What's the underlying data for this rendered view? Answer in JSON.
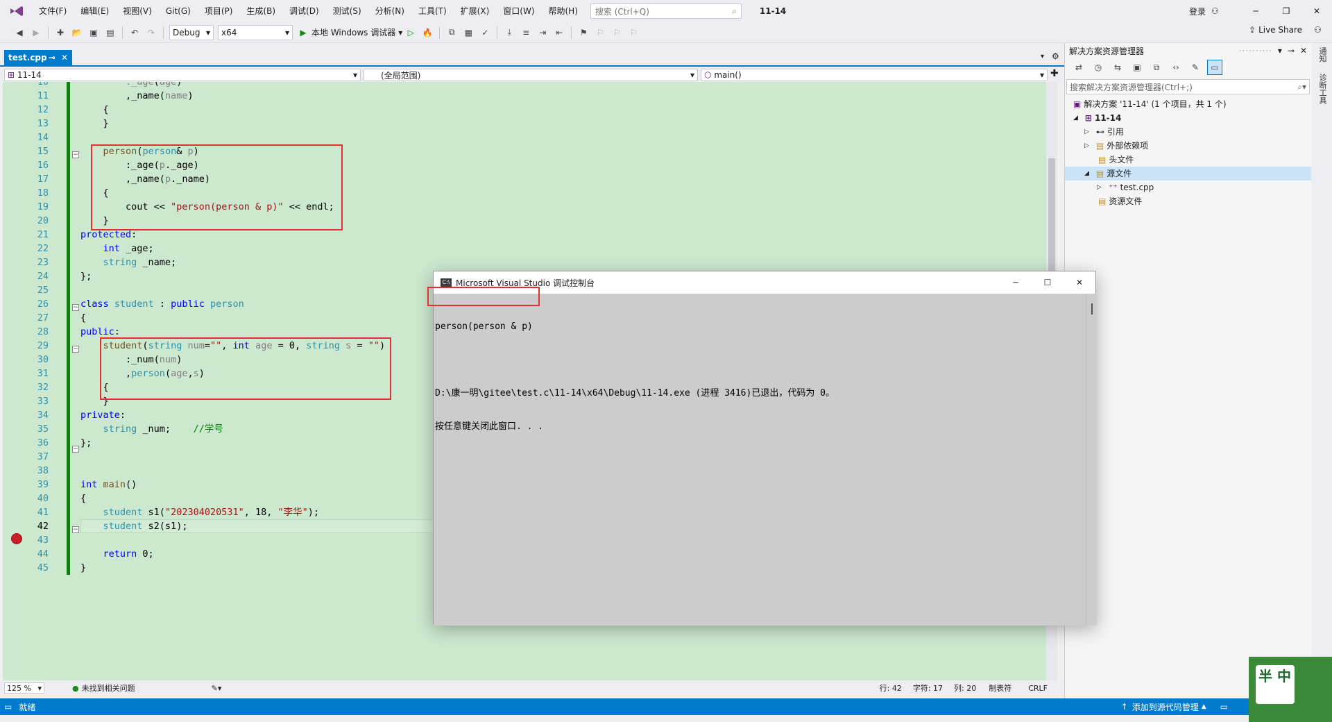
{
  "menu": [
    "文件(F)",
    "编辑(E)",
    "视图(V)",
    "Git(G)",
    "项目(P)",
    "生成(B)",
    "调试(D)",
    "测试(S)",
    "分析(N)",
    "工具(T)",
    "扩展(X)",
    "窗口(W)",
    "帮助(H)"
  ],
  "search": {
    "placeholder": "搜索 (Ctrl+Q)"
  },
  "window_title": "11-14",
  "account": {
    "login": "登录"
  },
  "toolbar": {
    "config": "Debug",
    "platform": "x64",
    "run_label": "本地 Windows 调试器",
    "live_share": "Live Share"
  },
  "tab": {
    "name": "test.cpp"
  },
  "navbar": {
    "project": "11-14",
    "scope": "(全局范围)",
    "member": "main()"
  },
  "editor": {
    "line_numbers": [
      "10",
      "11",
      "12",
      "13",
      "14",
      "15",
      "16",
      "17",
      "18",
      "19",
      "20",
      "21",
      "22",
      "23",
      "24",
      "25",
      "26",
      "27",
      "28",
      "29",
      "30",
      "31",
      "32",
      "33",
      "34",
      "35",
      "36",
      "37",
      "38",
      "39",
      "40",
      "41",
      "42",
      "43",
      "44",
      "45"
    ],
    "current_line": "42",
    "breakpoint_line": "43"
  },
  "status_row": {
    "zoom": "125 %",
    "issues": "未找到相关问题",
    "line": "行: 42",
    "char": "字符: 17",
    "col": "列: 20",
    "tabs": "制表符",
    "eol": "CRLF"
  },
  "statusbar": {
    "ready": "就绪",
    "source_control": "添加到源代码管理"
  },
  "solution": {
    "title": "解决方案资源管理器",
    "search_placeholder": "搜索解决方案资源管理器(Ctrl+;)",
    "items": [
      {
        "label": "解决方案 '11-14' (1 个项目，共 1 个)"
      },
      {
        "label": "11-14"
      },
      {
        "label": "引用"
      },
      {
        "label": "外部依赖项"
      },
      {
        "label": "头文件"
      },
      {
        "label": "源文件"
      },
      {
        "label": "test.cpp"
      },
      {
        "label": "资源文件"
      }
    ]
  },
  "side_tabs": [
    "通知",
    "诊断工具"
  ],
  "console": {
    "title": "Microsoft Visual Studio 调试控制台",
    "lines": [
      "person(person & p)",
      "",
      "D:\\康一明\\gitee\\test.c\\11-14\\x64\\Debug\\11-14.exe (进程 3416)已退出，代码为 0。",
      "按任意键关闭此窗口. . ."
    ]
  },
  "ime": {
    "chars": "半 中"
  },
  "colors": {
    "accent": "#007acc",
    "editor_bg": "#cce8cf",
    "highlight_box": "#e03030",
    "change_bar": "#107c10"
  }
}
